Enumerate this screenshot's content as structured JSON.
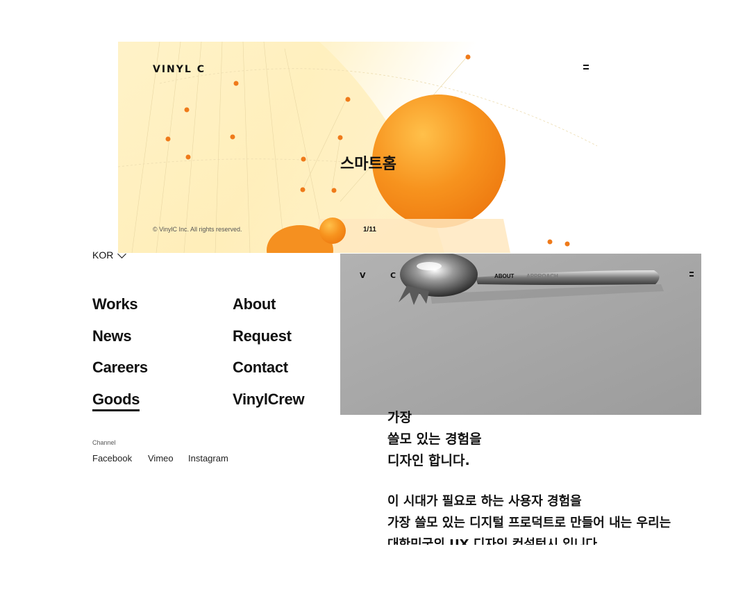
{
  "hero": {
    "logo": "VINYL C",
    "title": "스마트홈",
    "copyright": "© VinylC Inc. All rights reserved.",
    "pager": "1/11",
    "colors": {
      "accent": "#F5841F",
      "sphere": "#F7931E",
      "background": "#FFF5D6"
    }
  },
  "menu": {
    "language": "KOR",
    "items": [
      {
        "label": "Works"
      },
      {
        "label": "News"
      },
      {
        "label": "Careers"
      },
      {
        "label": "Goods",
        "active": true
      },
      {
        "label": "About"
      },
      {
        "label": "Request"
      },
      {
        "label": "Contact"
      },
      {
        "label": "VinylCrew"
      }
    ],
    "channel_label": "Channel",
    "channels": [
      "Facebook",
      "Vimeo",
      "Instagram"
    ]
  },
  "about": {
    "logo_left": "V",
    "logo_right": "C",
    "nav": [
      "ABOUT",
      "APPROACH"
    ],
    "headline": [
      "가장",
      "쓸모 있는 경험을",
      "디자인 합니다."
    ],
    "description": [
      "이 시대가 필요로 하는 사용자 경험을",
      "가장 쓸모 있는 디지털 프로덕트로 만들어 내는 우리는",
      "대한민국의 UX 디자인 컨설턴시 입니다."
    ]
  }
}
